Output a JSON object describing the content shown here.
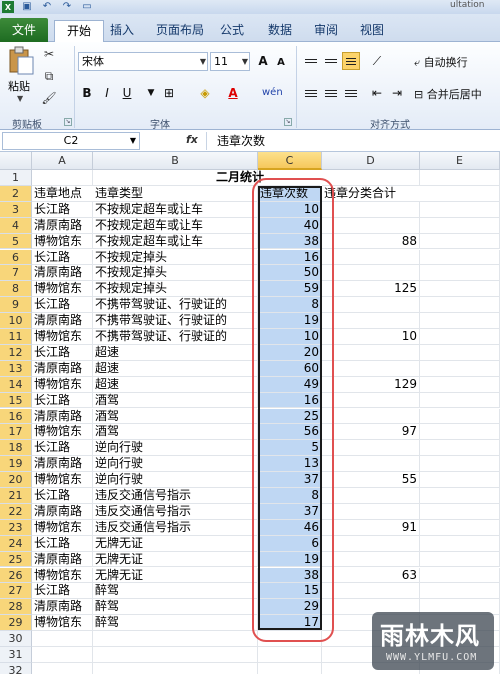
{
  "app": {
    "title_fragment": "ultation",
    "quick_access": [
      "save-icon",
      "undo-icon",
      "redo-icon",
      "new-document-icon"
    ]
  },
  "ribbon": {
    "tabs": [
      "文件",
      "开始",
      "插入",
      "页面布局",
      "公式",
      "数据",
      "审阅",
      "视图"
    ],
    "active_tab": "开始",
    "clipboard": {
      "paste_label": "粘贴",
      "group_label": "剪贴板"
    },
    "font": {
      "family": "宋体",
      "size": "11",
      "group_label": "字体",
      "bold": "B",
      "italic": "I",
      "underline": "U",
      "grow": "A",
      "shrink": "A",
      "font_color": "A",
      "phonetic": "wén"
    },
    "alignment": {
      "wrap_label": "自动换行",
      "merge_label": "合并后居中",
      "group_label": "对齐方式"
    }
  },
  "formula_bar": {
    "name_box": "C2",
    "fx": "fx",
    "content": "违章次数"
  },
  "columns": [
    "A",
    "B",
    "C",
    "D",
    "E"
  ],
  "rows": [
    "1",
    "2",
    "3",
    "4",
    "5",
    "6",
    "7",
    "8",
    "9",
    "10",
    "11",
    "12",
    "13",
    "14",
    "15",
    "16",
    "17",
    "18",
    "19",
    "20",
    "21",
    "22",
    "23",
    "24",
    "25",
    "26",
    "27",
    "28",
    "29",
    "30",
    "31",
    "32",
    "33"
  ],
  "sheet": {
    "title": "二月统计",
    "headers": {
      "a": "违章地点",
      "b": "违章类型",
      "c": "违章次数",
      "d": "违章分类合计"
    },
    "data": [
      {
        "a": "长江路",
        "b": "不按规定超车或让车",
        "c": "10",
        "d": ""
      },
      {
        "a": "清原南路",
        "b": "不按规定超车或让车",
        "c": "40",
        "d": ""
      },
      {
        "a": "博物馆东",
        "b": "不按规定超车或让车",
        "c": "38",
        "d": "88"
      },
      {
        "a": "长江路",
        "b": "不按规定掉头",
        "c": "16",
        "d": ""
      },
      {
        "a": "清原南路",
        "b": "不按规定掉头",
        "c": "50",
        "d": ""
      },
      {
        "a": "博物馆东",
        "b": "不按规定掉头",
        "c": "59",
        "d": "125"
      },
      {
        "a": "长江路",
        "b": "不携带驾驶证、行驶证的",
        "c": "8",
        "d": ""
      },
      {
        "a": "清原南路",
        "b": "不携带驾驶证、行驶证的",
        "c": "19",
        "d": ""
      },
      {
        "a": "博物馆东",
        "b": "不携带驾驶证、行驶证的",
        "c": "10",
        "d": "10"
      },
      {
        "a": "长江路",
        "b": "超速",
        "c": "20",
        "d": ""
      },
      {
        "a": "清原南路",
        "b": "超速",
        "c": "60",
        "d": ""
      },
      {
        "a": "博物馆东",
        "b": "超速",
        "c": "49",
        "d": "129"
      },
      {
        "a": "长江路",
        "b": "酒驾",
        "c": "16",
        "d": ""
      },
      {
        "a": "清原南路",
        "b": "酒驾",
        "c": "25",
        "d": ""
      },
      {
        "a": "博物馆东",
        "b": "酒驾",
        "c": "56",
        "d": "97"
      },
      {
        "a": "长江路",
        "b": "逆向行驶",
        "c": "5",
        "d": ""
      },
      {
        "a": "清原南路",
        "b": "逆向行驶",
        "c": "13",
        "d": ""
      },
      {
        "a": "博物馆东",
        "b": "逆向行驶",
        "c": "37",
        "d": "55"
      },
      {
        "a": "长江路",
        "b": "违反交通信号指示",
        "c": "8",
        "d": ""
      },
      {
        "a": "清原南路",
        "b": "违反交通信号指示",
        "c": "37",
        "d": ""
      },
      {
        "a": "博物馆东",
        "b": "违反交通信号指示",
        "c": "46",
        "d": "91"
      },
      {
        "a": "长江路",
        "b": "无牌无证",
        "c": "6",
        "d": ""
      },
      {
        "a": "清原南路",
        "b": "无牌无证",
        "c": "19",
        "d": ""
      },
      {
        "a": "博物馆东",
        "b": "无牌无证",
        "c": "38",
        "d": "63"
      },
      {
        "a": "长江路",
        "b": "醉驾",
        "c": "15",
        "d": ""
      },
      {
        "a": "清原南路",
        "b": "醉驾",
        "c": "29",
        "d": ""
      },
      {
        "a": "博物馆东",
        "b": "醉驾",
        "c": "17",
        "d": ""
      }
    ]
  },
  "watermark": {
    "text": "雨林木风",
    "url": "WWW.YLMFU.COM"
  }
}
